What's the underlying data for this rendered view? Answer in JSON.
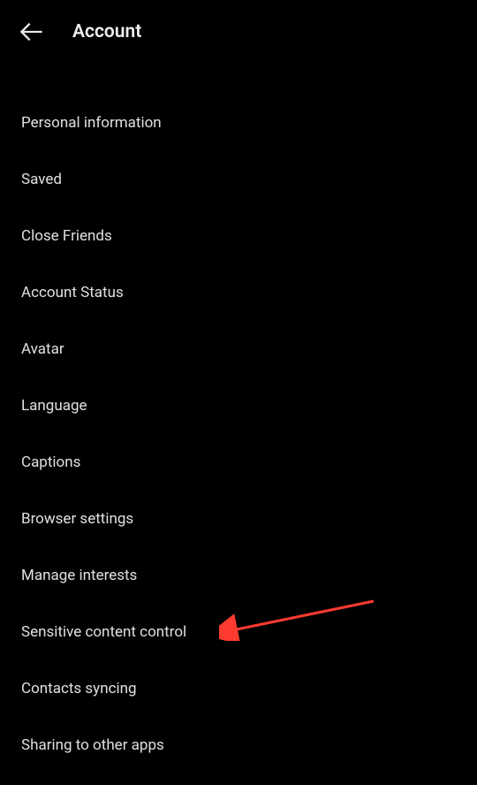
{
  "header": {
    "title": "Account"
  },
  "menu": {
    "items": [
      {
        "label": "Personal information"
      },
      {
        "label": "Saved"
      },
      {
        "label": "Close Friends"
      },
      {
        "label": "Account Status"
      },
      {
        "label": "Avatar"
      },
      {
        "label": "Language"
      },
      {
        "label": "Captions"
      },
      {
        "label": "Browser settings"
      },
      {
        "label": "Manage interests"
      },
      {
        "label": "Sensitive content control"
      },
      {
        "label": "Contacts syncing"
      },
      {
        "label": "Sharing to other apps"
      }
    ]
  },
  "annotation": {
    "arrow_color": "#ff3b30"
  }
}
